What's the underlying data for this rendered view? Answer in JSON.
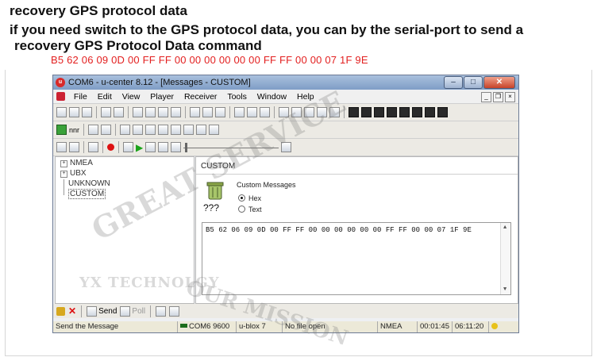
{
  "heading": {
    "line1": "recovery GPS protocol data",
    "line2": "if you need switch to the GPS protocol data, you can by the serial-port to send a",
    "line3": "recovery GPS Protocol Data command",
    "command_hex": "B5 62 06 09 0D 00 FF FF 00 00 00 00 00 00 FF FF 00 00 07 1F 9E"
  },
  "window": {
    "title": "COM6 - u-center 8.12 - [Messages - CUSTOM]",
    "app_icon_text": "u",
    "controls": {
      "minimize": "–",
      "maximize": "□",
      "close": "✕"
    },
    "mdi_controls": {
      "minimize": "_",
      "restore": "❐",
      "close": "×"
    }
  },
  "menu": [
    "File",
    "Edit",
    "View",
    "Player",
    "Receiver",
    "Tools",
    "Window",
    "Help"
  ],
  "toolbar2": {
    "baud_dropdown": "nnr"
  },
  "tree": {
    "items": [
      {
        "label": "NMEA",
        "expand": "+"
      },
      {
        "label": "UBX",
        "expand": "+"
      },
      {
        "label": "UNKNOWN",
        "expand": ""
      },
      {
        "label": "CUSTOM",
        "expand": ""
      }
    ]
  },
  "custom_panel": {
    "title": "CUSTOM",
    "question": "???",
    "group_label": "Custom Messages",
    "radio_hex": "Hex",
    "radio_text": "Text",
    "selected": "Hex",
    "message": "B5 62 06 09 0D 00 FF FF 00 00 00 00 00 00 FF FF 00 00 07 1F 9E"
  },
  "actions": {
    "send": "Send",
    "poll": "Poll"
  },
  "status": {
    "message": "Send the Message",
    "port": "COM6 9600",
    "receiver": "u-blox 7",
    "file": "No file open",
    "protocol": "NMEA",
    "elapsed": "00:01:45",
    "clock": "06:11:20"
  },
  "watermark": {
    "arc": "GREAT SERVICE",
    "company": "YX TECHNOLGY",
    "bottom": "OUR MISSION"
  }
}
